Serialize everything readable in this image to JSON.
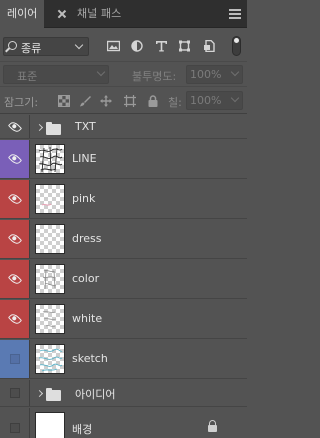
{
  "panel": {
    "tabs": [
      {
        "label": "레이어",
        "active": true
      },
      {
        "label": "채널",
        "active": false
      },
      {
        "label": "패스",
        "active": false
      }
    ]
  },
  "filter": {
    "kind_label": "종류",
    "icons": [
      "image-filter-icon",
      "adjustment-filter-icon",
      "type-filter-icon",
      "shape-filter-icon",
      "smart-object-filter-icon",
      "filter-toggle-icon"
    ]
  },
  "blend": {
    "mode": "표준",
    "opacity_label": "불투명도:",
    "opacity_value": "100%"
  },
  "lock": {
    "label": "잠그기:",
    "fill_label": "칠:",
    "fill_value": "100%"
  },
  "layers": [
    {
      "name": "TXT",
      "type": "group",
      "visible": true,
      "color": "none",
      "thumb": "folder"
    },
    {
      "name": "LINE",
      "type": "layer",
      "visible": true,
      "color": "#7a5fb8",
      "thumb": "sketch-dark"
    },
    {
      "name": "pink",
      "type": "layer",
      "visible": true,
      "color": "#b94444",
      "thumb": "transparent"
    },
    {
      "name": "dress",
      "type": "layer",
      "visible": true,
      "color": "#b94444",
      "thumb": "transparent"
    },
    {
      "name": "color",
      "type": "layer",
      "visible": true,
      "color": "#b94444",
      "thumb": "sketch-light"
    },
    {
      "name": "white",
      "type": "layer",
      "visible": true,
      "color": "#b94444",
      "thumb": "sketch-light"
    },
    {
      "name": "sketch",
      "type": "layer",
      "visible": false,
      "color": "#5a7ab3",
      "thumb": "sketch-blue"
    },
    {
      "name": "아이디어",
      "type": "group",
      "visible": false,
      "color": "none",
      "thumb": "folder"
    },
    {
      "name": "배경",
      "type": "background",
      "visible": false,
      "color": "none",
      "thumb": "white",
      "locked": true
    }
  ],
  "colors": {
    "panel_bg": "#535353",
    "tab_bar_bg": "#2f2f2f",
    "label_red": "#b94444",
    "label_violet": "#7a5fb8",
    "label_blue": "#5a7ab3"
  }
}
